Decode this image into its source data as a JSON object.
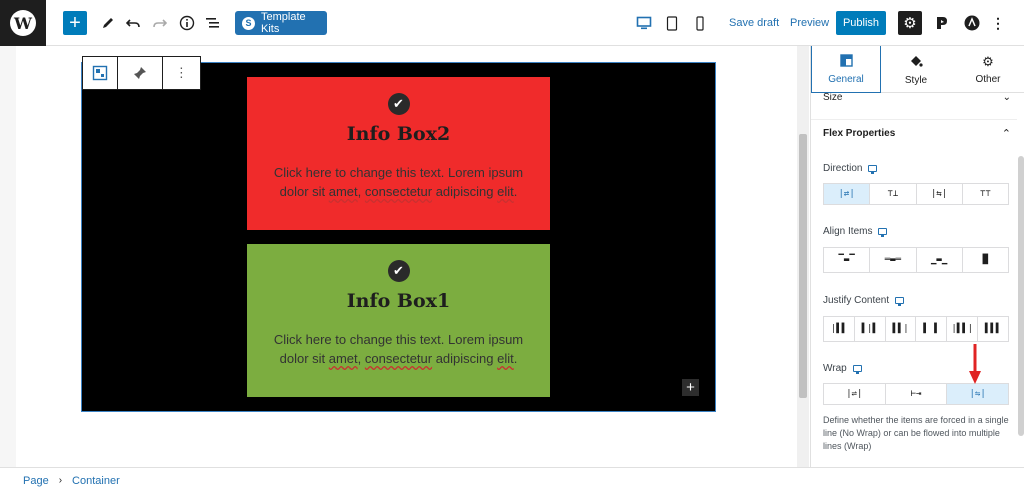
{
  "toolbar": {
    "template_kits_label": "Template Kits",
    "save_draft_label": "Save draft",
    "preview_label": "Preview",
    "publish_label": "Publish"
  },
  "block_toolbar": {
    "more_label": "⋮"
  },
  "info_boxes": [
    {
      "title": "Info Box2",
      "text_parts": [
        "Click here to change this text. Lorem ipsum dolor sit ",
        "amet",
        ", ",
        "consectetur",
        " adipiscing ",
        "elit",
        "."
      ],
      "color": "#f02b2b"
    },
    {
      "title": "Info Box1",
      "text_parts": [
        "Click here to change this text. Lorem ipsum dolor sit ",
        "amet",
        ", ",
        "consectetur",
        " adipiscing ",
        "elit",
        "."
      ],
      "color": "#7cad40"
    }
  ],
  "sidebar": {
    "tabs": [
      {
        "label": "General",
        "icon": "layout-icon",
        "active": true
      },
      {
        "label": "Style",
        "icon": "paint-bucket-icon",
        "active": false
      },
      {
        "label": "Other",
        "icon": "gear-icon",
        "active": false
      }
    ],
    "size_label": "Size",
    "flex_properties_label": "Flex Properties",
    "direction": {
      "label": "Direction",
      "selected_index": 0,
      "options": [
        "row",
        "column",
        "row-reverse",
        "column-reverse"
      ]
    },
    "align_items": {
      "label": "Align Items",
      "options": [
        "flex-start",
        "center",
        "flex-end",
        "stretch"
      ]
    },
    "justify_content": {
      "label": "Justify Content",
      "options": [
        "flex-start",
        "center",
        "flex-end",
        "space-between",
        "space-around",
        "space-evenly"
      ]
    },
    "wrap": {
      "label": "Wrap",
      "selected_index": 2,
      "options": [
        "no-wrap",
        "wrap",
        "wrap-reverse"
      ]
    },
    "wrap_help": "Define whether the items are forced in a single line (No Wrap) or can be flowed into multiple lines (Wrap)"
  },
  "breadcrumb": {
    "items": [
      "Page",
      "Container"
    ]
  },
  "colors": {
    "accent": "#007cba",
    "canvas_bg": "#000000",
    "annotation_arrow": "#e02424"
  }
}
